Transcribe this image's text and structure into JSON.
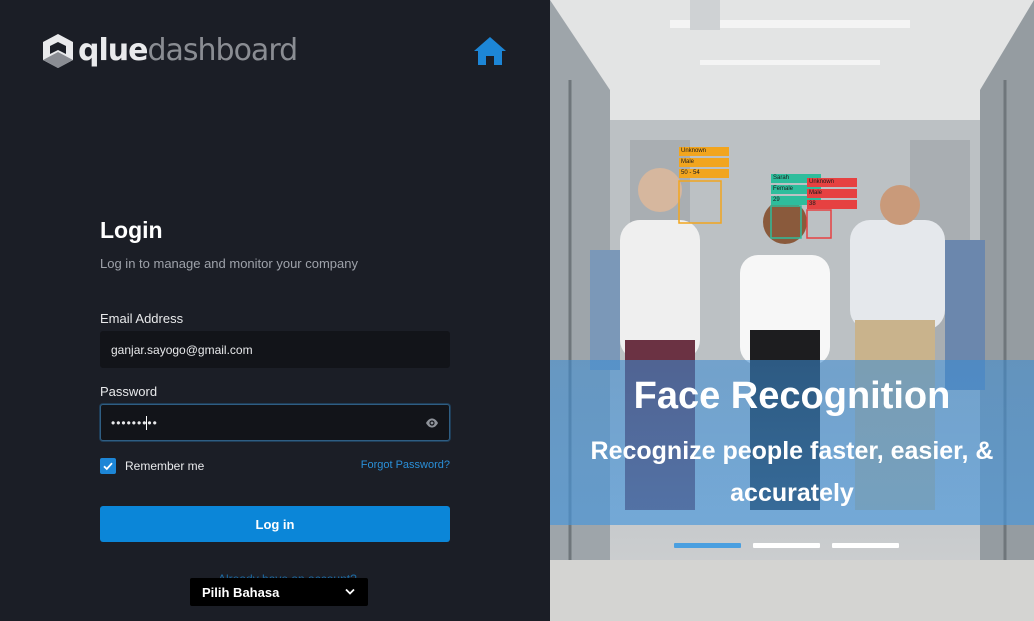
{
  "brand": {
    "prefix": "qlue",
    "suffix": "dashboard"
  },
  "login": {
    "title": "Login",
    "subtitle": "Log in to manage and monitor your company",
    "email_label": "Email Address",
    "email_value": "ganjar.sayogo@gmail.com",
    "password_label": "Password",
    "password_value": "•••••••••",
    "remember_label": "Remember me",
    "forgot_label": "Forgot Password?",
    "submit_label": "Log in",
    "secondary_link": "Already have an account?"
  },
  "language": {
    "label": "Pilih Bahasa"
  },
  "hero": {
    "title": "Face Recognition",
    "subtitle": "Recognize people faster, easier, & accurately",
    "slides": 3,
    "active_slide": 1
  },
  "detections": [
    {
      "lines": [
        "Unknown",
        "Male",
        "50 - 54"
      ],
      "color": "#f2a51e"
    },
    {
      "lines": [
        "Sarah",
        "Female",
        "29"
      ],
      "color": "#2ebd9c"
    },
    {
      "lines": [
        "Unknown",
        "Male",
        "38"
      ],
      "color": "#e64141"
    }
  ],
  "colors": {
    "accent": "#0b86d8",
    "panel": "#1b1e26",
    "input": "#121419"
  }
}
